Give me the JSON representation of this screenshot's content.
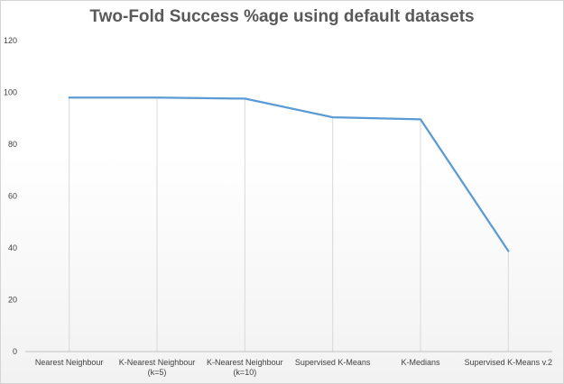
{
  "chart_data": {
    "type": "line",
    "title": "Two-Fold Success %age using default datasets",
    "xlabel": "",
    "ylabel": "",
    "categories": [
      [
        "Nearest Neighbour"
      ],
      [
        "K-Nearest Neighbour",
        "(k=5)"
      ],
      [
        "K-Nearest Neighbour",
        "(k=10)"
      ],
      [
        "Supervised K-Means"
      ],
      [
        "K-Medians"
      ],
      [
        "Supervised K-Means v.2"
      ]
    ],
    "series": [
      {
        "values": [
          98,
          98,
          97.6,
          90.4,
          89.6,
          38.8
        ]
      }
    ],
    "ylim": [
      0,
      120
    ],
    "yticks": [
      0,
      20,
      40,
      60,
      80,
      100,
      120
    ],
    "grid": "vertical",
    "legend": "none",
    "line_color": "#5b9bd5",
    "grid_color": "#d9d9d9",
    "axis_color": "#bfbfbf"
  }
}
